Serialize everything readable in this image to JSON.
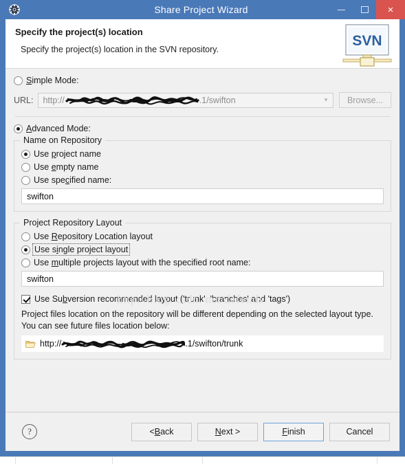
{
  "window": {
    "title": "Share Project Wizard",
    "icon": "gear-icon",
    "minimize_label": "–",
    "maximize_label": "□",
    "close_label": "×",
    "border_color": "#4a79b8",
    "close_color": "#d9534f"
  },
  "header": {
    "title": "Specify the project(s) location",
    "subtitle": "Specify the project(s) location in the SVN repository.",
    "logo_text": "SVN"
  },
  "watermark": "http://blog. csdn. net/defonds",
  "simple_mode": {
    "label_before": "S",
    "label_mnemonic": "S",
    "label": "Simple Mode:",
    "selected": false,
    "url_label": "URL:",
    "url_prefix": "http://",
    "url_redacted": "[redacted]",
    "url_suffix": ".1/swifton",
    "browse_label": "Browse...",
    "dropdown_icon": "chevron-down-icon"
  },
  "advanced_mode": {
    "label": "Advanced Mode:",
    "selected": true
  },
  "name_on_repository": {
    "group_title": "Name on Repository",
    "options": [
      {
        "label": "Use project name",
        "selected": true
      },
      {
        "label": "Use empty name",
        "selected": false
      },
      {
        "label": "Use specified name:",
        "selected": false
      }
    ],
    "specified_name_value": "swifton"
  },
  "project_repository_layout": {
    "group_title": "Project Repository Layout",
    "options": [
      {
        "label": "Use Repository Location layout",
        "selected": false,
        "focused": false
      },
      {
        "label": "Use single project layout",
        "selected": true,
        "focused": true
      },
      {
        "label": "Use multiple projects layout with the specified root name:",
        "selected": false,
        "focused": false
      }
    ],
    "root_name_value": "swifton",
    "recommended_layout_checkbox": {
      "label": "Use Subversion recommended layout ('trunk', 'branches' and 'tags')",
      "checked": true
    },
    "note_line1": "Project files location on the repository will be different depending on the selected layout",
    "note_line2": "type. You can see future files location below:",
    "preview_path": {
      "icon": "folder-icon",
      "prefix": "http://",
      "redacted": "[redacted]",
      "suffix": ".1/swifton/trunk"
    }
  },
  "footer": {
    "help_icon": "question-mark-icon",
    "help_label": "?",
    "buttons": [
      {
        "label": "< Back",
        "default": false
      },
      {
        "label": "Next >",
        "default": false
      },
      {
        "label": "Finish",
        "default": true
      },
      {
        "label": "Cancel",
        "default": false
      }
    ]
  }
}
